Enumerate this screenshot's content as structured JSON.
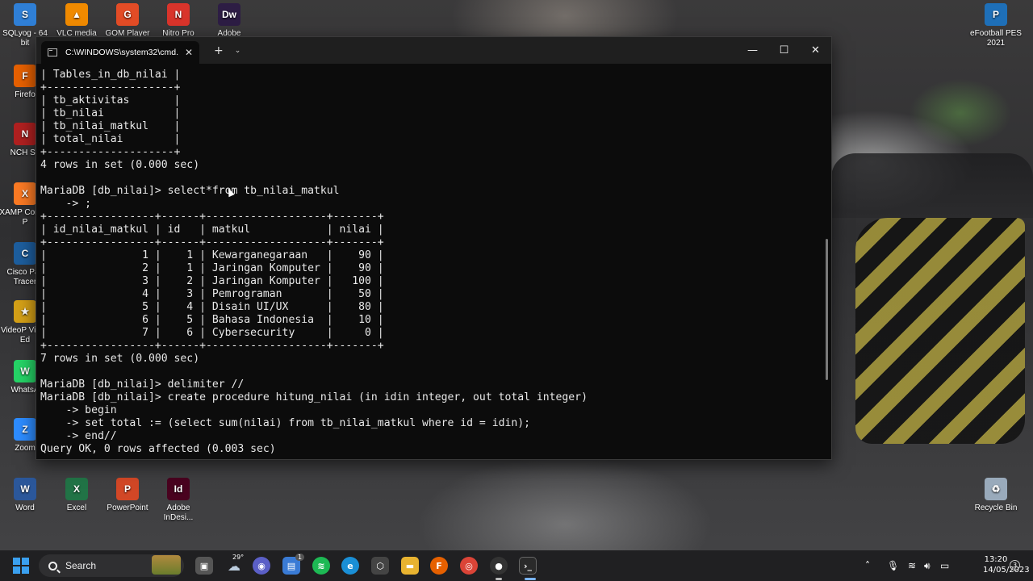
{
  "desktop": {
    "left_icons": [
      {
        "label": "SQLyog - 64 bit",
        "color": "#2f7fd6",
        "glyph": "S"
      },
      {
        "label": "VLC media",
        "color": "#f08a00",
        "glyph": "▲"
      },
      {
        "label": "GOM Player",
        "color": "#e34c26",
        "glyph": "G"
      },
      {
        "label": "Nitro Pro",
        "color": "#d9342b",
        "glyph": "N"
      },
      {
        "label": "Adobe",
        "color": "#2d1d44",
        "glyph": "Dw"
      },
      {
        "label": "Firefo",
        "color": "#e66000",
        "glyph": "F"
      },
      {
        "label": "NCH Su",
        "color": "#b02020",
        "glyph": "N"
      },
      {
        "label": "XAMP Control P",
        "color": "#fb7a24",
        "glyph": "X"
      },
      {
        "label": "Cisco Pac Tracer",
        "color": "#1d5e9e",
        "glyph": "C"
      },
      {
        "label": "VideoP Video Ed",
        "color": "#d4a017",
        "glyph": "★"
      },
      {
        "label": "WhatsA",
        "color": "#25d366",
        "glyph": "W"
      },
      {
        "label": "Zoom",
        "color": "#2d8cff",
        "glyph": "Z"
      },
      {
        "label": "Word",
        "color": "#2b579a",
        "glyph": "W"
      },
      {
        "label": "Excel",
        "color": "#217346",
        "glyph": "X"
      },
      {
        "label": "PowerPoint",
        "color": "#d24726",
        "glyph": "P"
      },
      {
        "label": "Adobe InDesi...",
        "color": "#49021f",
        "glyph": "Id"
      }
    ],
    "right_icons": [
      {
        "label": "eFootball PES 2021",
        "color": "#1e6fb8",
        "glyph": "P"
      },
      {
        "label": "Recycle Bin",
        "color": "#9ab",
        "glyph": "♻"
      }
    ]
  },
  "terminal": {
    "tab_title": "C:\\WINDOWS\\system32\\cmd.",
    "tab_close": "✕",
    "new_tab": "+",
    "dropdown": "⌄",
    "minimize": "—",
    "maximize": "☐",
    "close": "✕",
    "lines": [
      "| Tables_in_db_nilai |",
      "+--------------------+",
      "| tb_aktivitas       |",
      "| tb_nilai           |",
      "| tb_nilai_matkul    |",
      "| total_nilai        |",
      "+--------------------+",
      "4 rows in set (0.000 sec)",
      "",
      "MariaDB [db_nilai]> select*from tb_nilai_matkul",
      "    -> ;",
      "+-----------------+------+-------------------+-------+",
      "| id_nilai_matkul | id   | matkul            | nilai |",
      "+-----------------+------+-------------------+-------+",
      "|               1 |    1 | Kewarganegaraan   |    90 |",
      "|               2 |    1 | Jaringan Komputer |    90 |",
      "|               3 |    2 | Jaringan Komputer |   100 |",
      "|               4 |    3 | Pemrograman       |    50 |",
      "|               5 |    4 | Disain UI/UX      |    80 |",
      "|               6 |    5 | Bahasa Indonesia  |    10 |",
      "|               7 |    6 | Cybersecurity     |     0 |",
      "+-----------------+------+-------------------+-------+",
      "7 rows in set (0.000 sec)",
      "",
      "MariaDB [db_nilai]> delimiter //",
      "MariaDB [db_nilai]> create procedure hitung_nilai (in idin integer, out total integer)",
      "    -> begin",
      "    -> set total := (select sum(nilai) from tb_nilai_matkul where id = idin);",
      "    -> end//",
      "Query OK, 0 rows affected (0.003 sec)"
    ]
  },
  "taskbar": {
    "search_label": "Search",
    "weather_temp": "29°",
    "store_badge": "1",
    "time": "13:20",
    "date": "14/05/2023",
    "notifications": "3"
  }
}
